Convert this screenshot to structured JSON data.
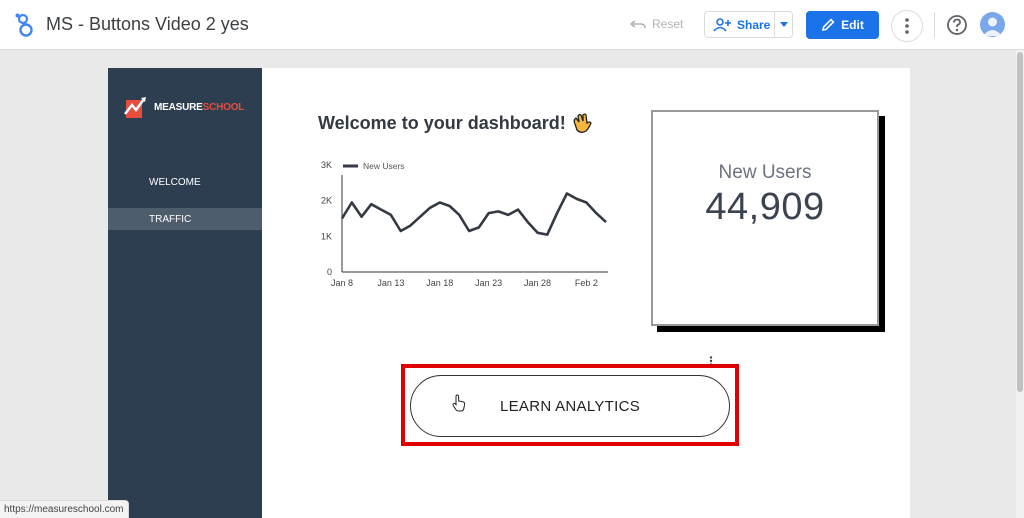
{
  "header": {
    "title": "MS - Buttons Video 2 yes",
    "reset_label": "Reset",
    "share_label": "Share",
    "edit_label": "Edit"
  },
  "sidebar": {
    "logo_text_a": "MEASURE",
    "logo_text_b": "SCHOOL",
    "items": [
      {
        "label": "WELCOME"
      },
      {
        "label": "TRAFFIC"
      }
    ]
  },
  "main": {
    "welcome_title": "Welcome to your dashboard!",
    "button_label": "LEARN ANALYTICS"
  },
  "scorecard": {
    "label": "New Users",
    "value": "44,909"
  },
  "status_url": "https://measureschool.com",
  "colors": {
    "primary_blue": "#1a73e8",
    "sidebar_bg": "#2d3e50",
    "highlight_red": "#e00000",
    "line_color": "#333a44"
  },
  "chart_data": {
    "type": "line",
    "legend": "New Users",
    "legend_position": "top-left",
    "x_ticks": [
      "Jan 8",
      "Jan 13",
      "Jan 18",
      "Jan 23",
      "Jan 28",
      "Feb 2"
    ],
    "y_ticks": [
      "0",
      "1K",
      "2K",
      "3K"
    ],
    "ylim": [
      0,
      3000
    ],
    "grid": false,
    "series": [
      {
        "name": "New Users",
        "values": [
          1500,
          1950,
          1550,
          1900,
          1750,
          1600,
          1150,
          1300,
          1550,
          1800,
          1950,
          1850,
          1600,
          1150,
          1250,
          1650,
          1700,
          1600,
          1750,
          1400,
          1100,
          1050,
          1650,
          2200,
          2050,
          1950,
          1650,
          1400
        ]
      }
    ]
  }
}
